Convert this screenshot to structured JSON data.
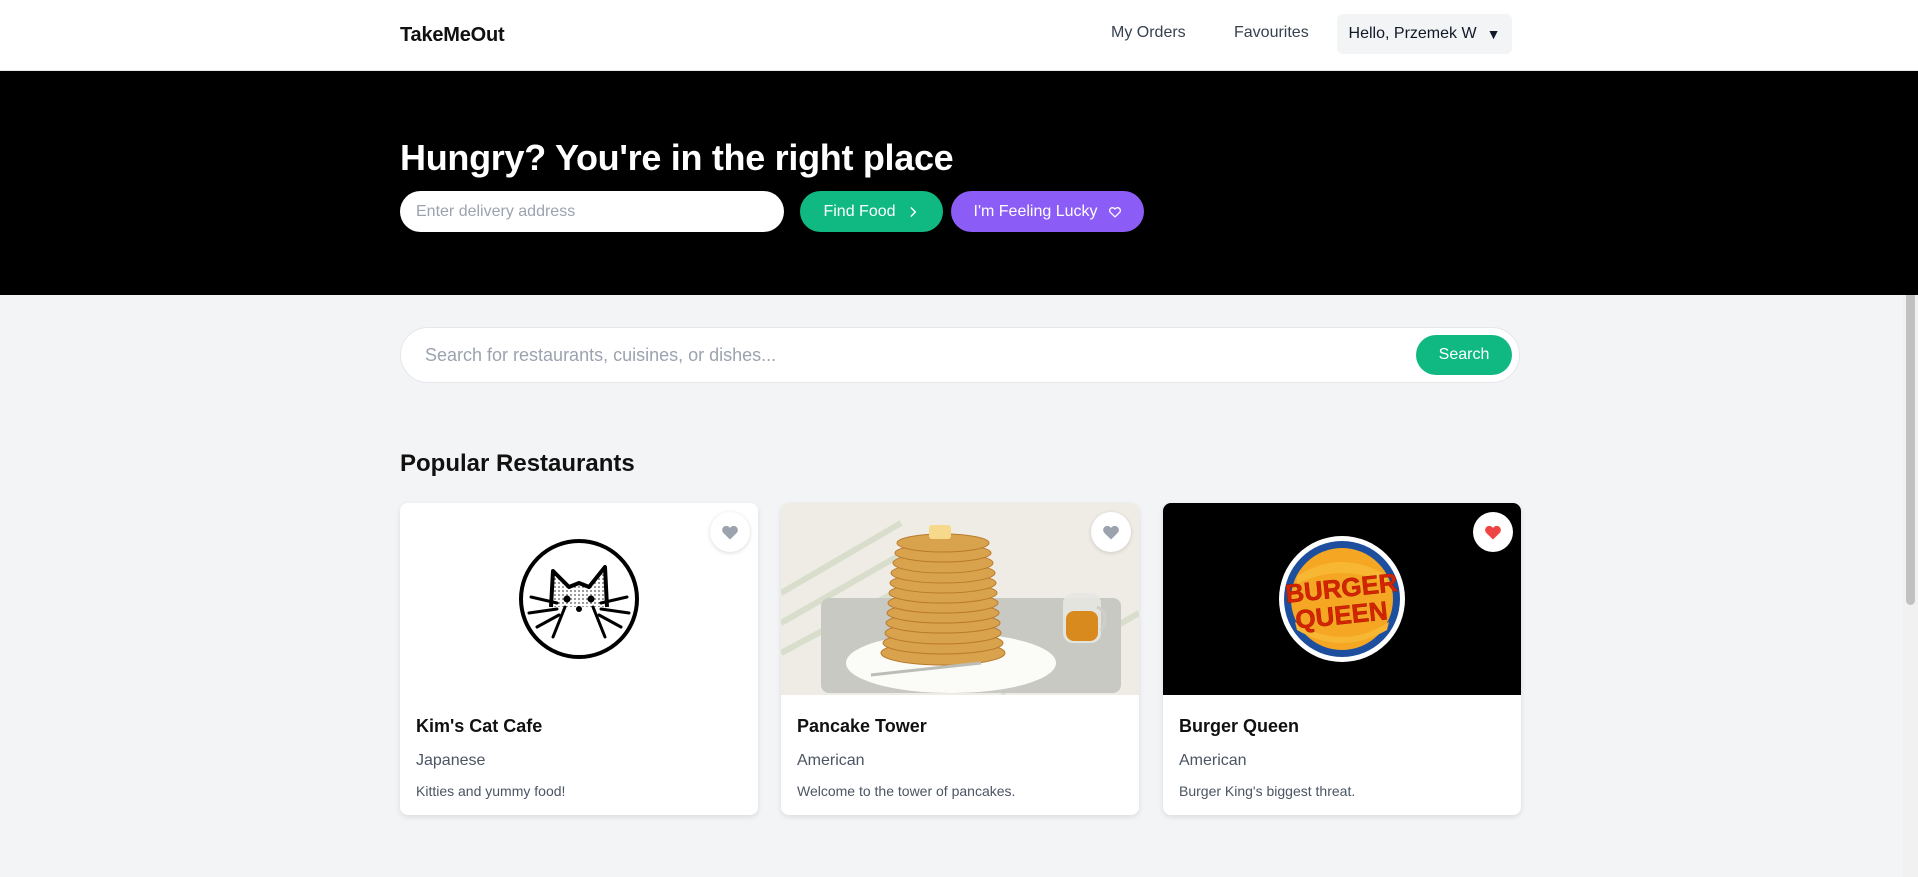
{
  "header": {
    "logo": "TakeMeOut",
    "nav": {
      "orders": "My Orders",
      "favourites": "Favourites"
    },
    "user_greeting": "Hello, Przemek W",
    "user_caret": "▼"
  },
  "hero": {
    "title": "Hungry? You're in the right place",
    "address_placeholder": "Enter delivery address",
    "find_food_label": "Find Food",
    "lucky_label": "I'm Feeling Lucky"
  },
  "search": {
    "placeholder": "Search for restaurants, cuisines, or dishes...",
    "button_label": "Search"
  },
  "popular": {
    "title": "Popular Restaurants",
    "restaurants": [
      {
        "name": "Kim's Cat Cafe",
        "cuisine": "Japanese",
        "description": "Kitties and yummy food!",
        "favourite": false,
        "image": "cat-logo"
      },
      {
        "name": "Pancake Tower",
        "cuisine": "American",
        "description": "Welcome to the tower of pancakes.",
        "favourite": false,
        "image": "pancake-photo"
      },
      {
        "name": "Burger Queen",
        "cuisine": "American",
        "description": "Burger King's biggest threat.",
        "favourite": true,
        "image": "burger-queen-logo",
        "logo_text": [
          "BURGER",
          "QUEEN"
        ]
      }
    ]
  },
  "colors": {
    "accent_green": "#10b981",
    "accent_purple": "#8b5cf6",
    "heart_active": "#ef4444",
    "heart_inactive": "#9ca3af"
  }
}
